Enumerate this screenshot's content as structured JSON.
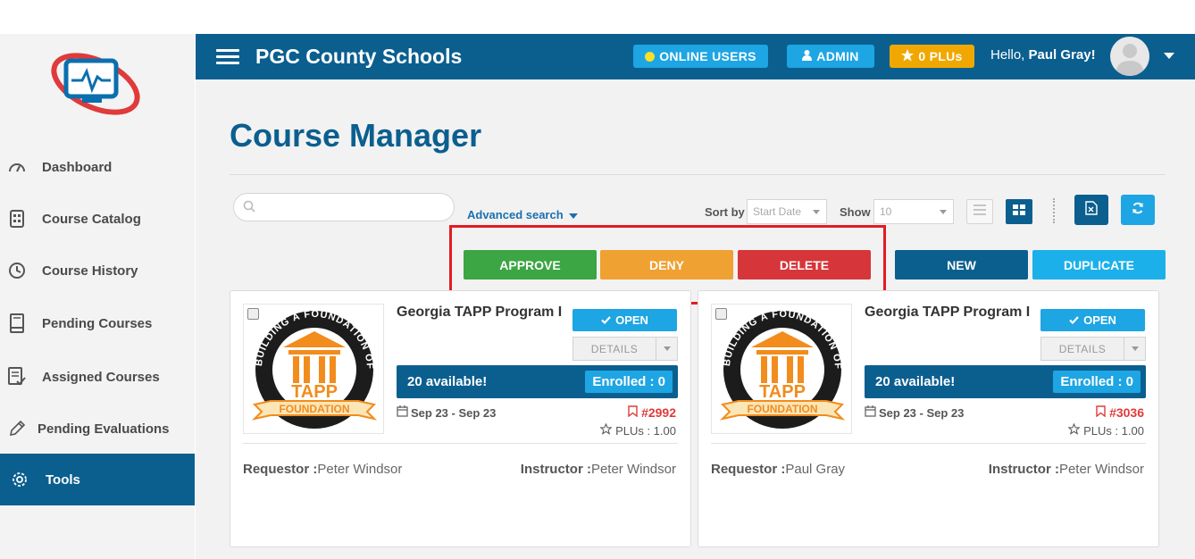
{
  "topbar": {
    "site_title": "PGC County Schools",
    "online_users": "ONLINE USERS",
    "admin": "ADMIN",
    "plus": "0 PLUs",
    "hello_prefix": "Hello, ",
    "user_name": "Paul Gray!",
    "colors": {
      "bar": "#0b5f8f",
      "online": "#1ea5e3",
      "admin": "#1ea5e3",
      "plus": "#f0a800",
      "online_dot": "#f7e02a"
    }
  },
  "sidebar": {
    "items": [
      {
        "label": "Dashboard",
        "icon": "gauge-icon"
      },
      {
        "label": "Course Catalog",
        "icon": "catalog-icon"
      },
      {
        "label": "Course History",
        "icon": "clock-icon"
      },
      {
        "label": "Pending Courses",
        "icon": "book-icon"
      },
      {
        "label": "Assigned Courses",
        "icon": "list-check-icon"
      },
      {
        "label": "Pending Evaluations",
        "icon": "pencil-icon"
      },
      {
        "label": "Tools",
        "icon": "gear-icon",
        "active": true
      }
    ]
  },
  "main": {
    "title": "Course Manager",
    "search": {
      "placeholder": "",
      "value": ""
    },
    "advanced_search": "Advanced search",
    "sort_label": "Sort by",
    "sort_value": "Start Date",
    "show_label": "Show",
    "show_value": "10",
    "actions": {
      "approve": "APPROVE",
      "deny": "DENY",
      "delete": "DELETE",
      "new": "NEW",
      "duplicate": "DUPLICATE"
    }
  },
  "cards": [
    {
      "title": "Georgia TAPP Program I",
      "open_label": "OPEN",
      "details_label": "DETAILS",
      "available": "20 available!",
      "enrolled": "Enrolled : 0",
      "dates": "Sep 23 - Sep 23",
      "number": "#2992",
      "plus": "PLUs : 1.00",
      "requestor_label": "Requestor :",
      "requestor": "Peter Windsor",
      "instructor_label": "Instructor :",
      "instructor": "Peter Windsor"
    },
    {
      "title": "Georgia TAPP Program I",
      "open_label": "OPEN",
      "details_label": "DETAILS",
      "available": "20 available!",
      "enrolled": "Enrolled : 0",
      "dates": "Sep 23 - Sep 23",
      "number": "#3036",
      "plus": "PLUs : 1.00",
      "requestor_label": "Requestor :",
      "requestor": "Paul Gray",
      "instructor_label": "Instructor :",
      "instructor": "Peter Windsor"
    }
  ],
  "logo": {
    "arc_text": "BUILDING A FOUNDATION OF SUCCESS",
    "word1": "TAPP",
    "word2": "FOUNDATION"
  }
}
